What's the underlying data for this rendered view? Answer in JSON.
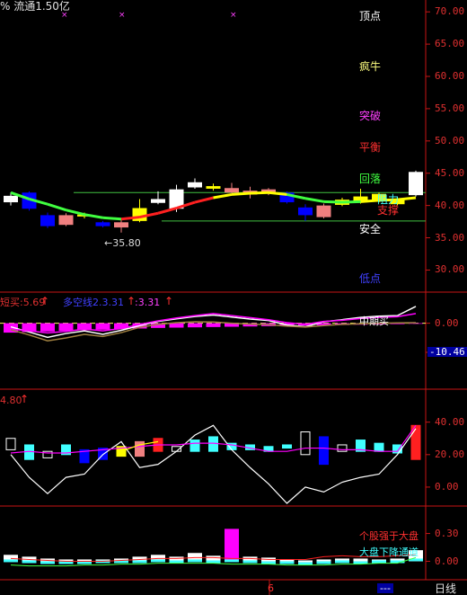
{
  "header": {
    "top_text": "% 流通1.50亿",
    "marker_glyph": "×"
  },
  "colors": {
    "background": "#000000",
    "axis_red": "#c81414",
    "bull": "#ffffff",
    "bear": "#0000ff",
    "yellow": "#ffff00",
    "salmon": "#f08080",
    "magenta": "#ff00ff",
    "green_line": "#40ff40",
    "cyan": "#40ffff",
    "value_box_blue": "#0000a0"
  },
  "main_panel": {
    "y_ticks": [
      "70.00",
      "65.00",
      "60.00",
      "55.00",
      "50.00",
      "45.00",
      "40.00",
      "35.00",
      "30.00"
    ],
    "levels": [
      {
        "label": "顶点",
        "color": "#ffffff"
      },
      {
        "label": "疯牛",
        "color": "#ffff80"
      },
      {
        "label": "突破",
        "color": "#ff40ff"
      },
      {
        "label": "平衡",
        "color": "#ff3030"
      },
      {
        "label": "回落",
        "color": "#40ff40"
      },
      {
        "label": "阻力",
        "color": "#40ffff"
      },
      {
        "label": "支撑",
        "color": "#ff3030"
      },
      {
        "label": "安全",
        "color": "#ffffff"
      },
      {
        "label": "低点",
        "color": "#4040ff"
      }
    ],
    "low_marker": "←35.80",
    "resistance_price": 42.0,
    "safety_price": 37.6
  },
  "panel2": {
    "label_left": "短买:5.69",
    "label_mid": "多空线2.3.31",
    "label_right": ":3.31",
    "y_ticks": [
      "0.00",
      "-10.46"
    ],
    "signal_label": "中期买"
  },
  "panel3": {
    "label_left": "4.80",
    "y_ticks": [
      "40.00",
      "20.00",
      "0.00"
    ]
  },
  "panel4": {
    "y_ticks": [
      "0.30",
      "0.00"
    ],
    "label_strong": "个股强于大盘",
    "label_channel": "大盘下降通道"
  },
  "footer": {
    "date_label": "6",
    "dashes": "---",
    "period": "日线"
  },
  "chart_data": [
    {
      "type": "candlestick",
      "ylim": [
        27,
        71
      ],
      "candles": [
        {
          "o": 41.5,
          "c": 40.5,
          "h": 42.0,
          "l": 40.0,
          "color": "white"
        },
        {
          "o": 42.0,
          "c": 39.5,
          "h": 42.2,
          "l": 39.2,
          "color": "blue"
        },
        {
          "o": 38.5,
          "c": 36.8,
          "h": 38.9,
          "l": 36.5,
          "color": "blue"
        },
        {
          "o": 37.0,
          "c": 38.5,
          "h": 38.8,
          "l": 36.8,
          "color": "salmon"
        },
        {
          "o": 38.3,
          "c": 38.6,
          "h": 38.9,
          "l": 38.0,
          "color": "yellow"
        },
        {
          "o": 37.4,
          "c": 36.8,
          "h": 37.6,
          "l": 36.6,
          "color": "blue"
        },
        {
          "o": 36.6,
          "c": 37.4,
          "h": 37.7,
          "l": 35.8,
          "color": "salmon"
        },
        {
          "o": 37.6,
          "c": 39.6,
          "h": 41.0,
          "l": 37.4,
          "color": "yellow"
        },
        {
          "o": 40.4,
          "c": 41.0,
          "h": 42.2,
          "l": 40.2,
          "color": "white"
        },
        {
          "o": 39.5,
          "c": 42.5,
          "h": 43.2,
          "l": 39.0,
          "color": "white"
        },
        {
          "o": 42.8,
          "c": 43.6,
          "h": 44.2,
          "l": 42.6,
          "color": "white"
        },
        {
          "o": 42.6,
          "c": 43.0,
          "h": 43.4,
          "l": 42.3,
          "color": "yellow"
        },
        {
          "o": 42.0,
          "c": 42.7,
          "h": 43.5,
          "l": 41.9,
          "color": "salmon"
        },
        {
          "o": 42.3,
          "c": 41.7,
          "h": 42.9,
          "l": 41.1,
          "color": "salmon"
        },
        {
          "o": 42.0,
          "c": 42.5,
          "h": 42.7,
          "l": 41.6,
          "color": "salmon"
        },
        {
          "o": 42.0,
          "c": 40.5,
          "h": 42.2,
          "l": 40.3,
          "color": "blue"
        },
        {
          "o": 39.7,
          "c": 38.5,
          "h": 40.2,
          "l": 37.6,
          "color": "blue"
        },
        {
          "o": 38.2,
          "c": 40.0,
          "h": 40.3,
          "l": 38.0,
          "color": "salmon"
        },
        {
          "o": 40.1,
          "c": 40.9,
          "h": 41.2,
          "l": 39.9,
          "color": "yellow"
        },
        {
          "o": 40.5,
          "c": 41.4,
          "h": 42.6,
          "l": 40.3,
          "color": "yellow"
        },
        {
          "o": 40.7,
          "c": 41.8,
          "h": 42.0,
          "l": 40.5,
          "color": "yellow"
        },
        {
          "o": 40.2,
          "c": 40.9,
          "h": 41.4,
          "l": 40.0,
          "color": "yellow"
        },
        {
          "o": 41.6,
          "c": 45.2,
          "h": 45.4,
          "l": 41.4,
          "color": "white"
        }
      ],
      "ma": [
        42,
        41,
        40.2,
        39.3,
        38.6,
        38.1,
        37.9,
        38.2,
        38.8,
        39.6,
        40.5,
        41.2,
        41.7,
        41.9,
        42.0,
        41.7,
        41.1,
        40.6,
        40.5,
        40.6,
        40.8,
        40.9,
        41.2
      ],
      "ma_colors": [
        "green",
        "green",
        "green",
        "green",
        "green",
        "green",
        "red",
        "red",
        "red",
        "red",
        "red",
        "yellow",
        "yellow",
        "yellow",
        "yellow",
        "green",
        "green",
        "green",
        "green",
        "yellow",
        "yellow",
        "yellow",
        "yellow"
      ]
    },
    {
      "type": "bar",
      "ylim": [
        -20,
        6
      ],
      "bars": [
        -3.2,
        -3.0,
        -2.8,
        -2.6,
        -2.4,
        -2.2,
        -2.0,
        -1.8,
        -1.6,
        -1.5,
        -1.4,
        -1.3,
        -1.2,
        -1.1,
        -1.0,
        -0.9,
        -0.8,
        -0.7,
        -0.6,
        -0.5,
        -0.4,
        -0.3,
        -0.2
      ],
      "bar_color": "magenta",
      "series": [
        {
          "values": [
            -1.2,
            -3.0,
            -4.8,
            -3.5,
            -2.6,
            -3.8,
            -2.4,
            -0.8,
            0.6,
            1.5,
            2.3,
            2.8,
            2.1,
            1.4,
            0.9,
            -0.6,
            -1.2,
            0.5,
            1.2,
            2.0,
            2.4,
            2.6,
            5.7
          ],
          "color": "white"
        },
        {
          "values": [
            -2.0,
            -2.6,
            -3.3,
            -2.8,
            -2.0,
            -2.6,
            -1.8,
            -0.4,
            0.8,
            1.8,
            2.6,
            3.3,
            2.6,
            1.9,
            1.2,
            0.2,
            -0.4,
            0.6,
            1.0,
            1.6,
            2.0,
            2.2,
            3.3
          ],
          "color": "magenta"
        },
        {
          "values": [
            -2.2,
            -4.0,
            -6.0,
            -5.0,
            -3.8,
            -4.5,
            -3.2,
            -1.4,
            -0.4,
            0.2,
            0.5,
            0.4,
            0.0,
            -0.3,
            -0.5,
            -1.0,
            -1.3,
            -0.8,
            -0.4,
            -0.2,
            0.0,
            0.1,
            0.2
          ],
          "color": "olive"
        }
      ]
    },
    {
      "type": "bar",
      "ylim": [
        -10,
        52
      ],
      "bars": [
        {
          "top": 30,
          "bot": 23,
          "color": "white"
        },
        {
          "top": 26,
          "bot": 17,
          "color": "cyan"
        },
        {
          "top": 22,
          "bot": 18,
          "color": "white"
        },
        {
          "top": 26,
          "bot": 20,
          "color": "cyan"
        },
        {
          "top": 23,
          "bot": 15,
          "color": "blue"
        },
        {
          "top": 24,
          "bot": 17,
          "color": "blue"
        },
        {
          "top": 25,
          "bot": 19,
          "color": "yellow"
        },
        {
          "top": 28,
          "bot": 19,
          "color": "salmon"
        },
        {
          "top": 30,
          "bot": 22,
          "color": "red"
        },
        {
          "top": 25,
          "bot": 22,
          "color": "white"
        },
        {
          "top": 29,
          "bot": 22,
          "color": "cyan"
        },
        {
          "top": 31,
          "bot": 22,
          "color": "cyan"
        },
        {
          "top": 27,
          "bot": 23,
          "color": "cyan"
        },
        {
          "top": 26,
          "bot": 23,
          "color": "cyan"
        },
        {
          "top": 25,
          "bot": 22,
          "color": "cyan"
        },
        {
          "top": 26,
          "bot": 24,
          "color": "cyan"
        },
        {
          "top": 34,
          "bot": 20,
          "color": "white"
        },
        {
          "top": 31,
          "bot": 14,
          "color": "blue"
        },
        {
          "top": 26,
          "bot": 22,
          "color": "white"
        },
        {
          "top": 29,
          "bot": 22,
          "color": "cyan"
        },
        {
          "top": 27,
          "bot": 22,
          "color": "cyan"
        },
        {
          "top": 26,
          "bot": 21,
          "color": "cyan"
        },
        {
          "top": 38,
          "bot": 17,
          "color": "red"
        }
      ],
      "series": [
        {
          "values": [
            20,
            6,
            -4,
            6,
            8,
            20,
            28,
            12,
            14,
            22,
            32,
            38,
            23,
            12,
            2,
            -10,
            0,
            -3,
            3,
            6,
            8,
            20,
            36
          ],
          "color": "white"
        },
        {
          "values": [
            21,
            22,
            21,
            21,
            22,
            23,
            24,
            25,
            26,
            26,
            27,
            27,
            26,
            24,
            22,
            22,
            24,
            24,
            23,
            23,
            22,
            22,
            38
          ],
          "color": "magenta"
        },
        {
          "values": [
            null,
            null,
            null,
            null,
            null,
            null,
            22,
            26,
            28,
            null,
            null,
            null,
            null,
            null,
            null,
            null,
            null,
            null,
            null,
            null,
            null,
            null,
            null
          ],
          "color": "yellow"
        },
        {
          "values": [
            null,
            null,
            null,
            null,
            null,
            null,
            null,
            null,
            null,
            null,
            null,
            null,
            null,
            null,
            null,
            null,
            null,
            null,
            null,
            null,
            null,
            null,
            null
          ],
          "color": "yellow"
        }
      ]
    },
    {
      "type": "bar",
      "ylim": [
        -0.15,
        0.48
      ],
      "bars": [
        {
          "top": 0.07,
          "bot": 0.0,
          "color": "white"
        },
        {
          "top": 0.05,
          "bot": 0.0,
          "color": "white"
        },
        {
          "top": 0.03,
          "bot": 0.0,
          "color": "white"
        },
        {
          "top": 0.02,
          "bot": 0.0,
          "color": "white"
        },
        {
          "top": 0.02,
          "bot": 0.0,
          "color": "white"
        },
        {
          "top": 0.02,
          "bot": 0.0,
          "color": "white"
        },
        {
          "top": 0.03,
          "bot": 0.0,
          "color": "white"
        },
        {
          "top": 0.05,
          "bot": 0.0,
          "color": "white"
        },
        {
          "top": 0.07,
          "bot": 0.0,
          "color": "white"
        },
        {
          "top": 0.05,
          "bot": 0.0,
          "color": "white"
        },
        {
          "top": 0.09,
          "bot": 0.0,
          "color": "white"
        },
        {
          "top": 0.06,
          "bot": 0.0,
          "color": "white"
        },
        {
          "top": 0.35,
          "bot": 0.0,
          "color": "magenta"
        },
        {
          "top": 0.05,
          "bot": 0.0,
          "color": "white"
        },
        {
          "top": 0.04,
          "bot": 0.0,
          "color": "white"
        },
        {
          "top": 0.02,
          "bot": 0.0,
          "color": "white"
        },
        {
          "top": 0.01,
          "bot": 0.0,
          "color": "white"
        },
        {
          "top": 0.02,
          "bot": 0.0,
          "color": "white"
        },
        {
          "top": 0.03,
          "bot": 0.0,
          "color": "white"
        },
        {
          "top": 0.03,
          "bot": 0.0,
          "color": "white"
        },
        {
          "top": 0.02,
          "bot": 0.0,
          "color": "white"
        },
        {
          "top": 0.03,
          "bot": 0.0,
          "color": "white"
        },
        {
          "top": 0.12,
          "bot": 0.0,
          "color": "white"
        }
      ],
      "cyan_bars": [
        0.02,
        0.01,
        0.0,
        0.0,
        0.0,
        0.01,
        0.01,
        0.01,
        0.02,
        0.01,
        0.02,
        0.01,
        0.02,
        0.01,
        0.0,
        0.0,
        -0.01,
        0.0,
        0.01,
        0.0,
        0.01,
        0.01,
        0.03
      ],
      "series": [
        {
          "values": [
            -0.04,
            -0.05,
            -0.05,
            -0.05,
            -0.04,
            -0.04,
            -0.03,
            -0.03,
            -0.02,
            -0.02,
            -0.02,
            -0.02,
            -0.03,
            -0.03,
            -0.03,
            -0.04,
            -0.04,
            -0.04,
            -0.03,
            -0.03,
            -0.02,
            -0.02,
            0.04
          ],
          "color": "green"
        },
        {
          "values": [
            0.03,
            0.02,
            0.01,
            0.0,
            0.0,
            0.0,
            0.01,
            0.02,
            0.03,
            0.03,
            0.04,
            0.04,
            0.03,
            0.03,
            0.02,
            0.02,
            0.02,
            0.05,
            0.06,
            0.05,
            0.05,
            0.06,
            0.07
          ],
          "color": "red"
        }
      ]
    }
  ]
}
